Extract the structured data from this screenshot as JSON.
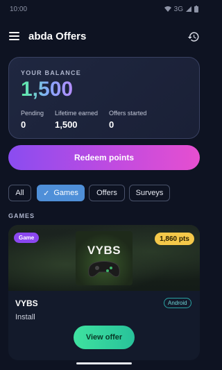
{
  "status_bar": {
    "time": "10:00",
    "network": "3G"
  },
  "app_bar": {
    "title": "abda Offers",
    "menu_icon": "menu-icon",
    "history_icon": "history-icon"
  },
  "balance": {
    "label": "YOUR BALANCE",
    "value": "1,500",
    "stats": [
      {
        "label": "Pending",
        "value": "0"
      },
      {
        "label": "Lifetime earned",
        "value": "1,500"
      },
      {
        "label": "Offers started",
        "value": "0"
      }
    ]
  },
  "redeem_label": "Redeem points",
  "filters": [
    {
      "label": "All",
      "selected": false
    },
    {
      "label": "Games",
      "selected": true
    },
    {
      "label": "Offers",
      "selected": false
    },
    {
      "label": "Surveys",
      "selected": false
    }
  ],
  "section_label": "GAMES",
  "offer": {
    "badge": "Game",
    "points": "1,860 pts",
    "thumbnail_title": "VYBS",
    "title": "VYBS",
    "platform": "Android",
    "subtitle": "Install",
    "cta": "View offer"
  },
  "colors": {
    "background": "#0e1322",
    "accent_purple": "#8a4cf0",
    "accent_pink": "#e64fd0",
    "chip_active": "#4f8fd8",
    "points_badge": "#f4c84a",
    "cta_green": "#3fe2a0"
  }
}
